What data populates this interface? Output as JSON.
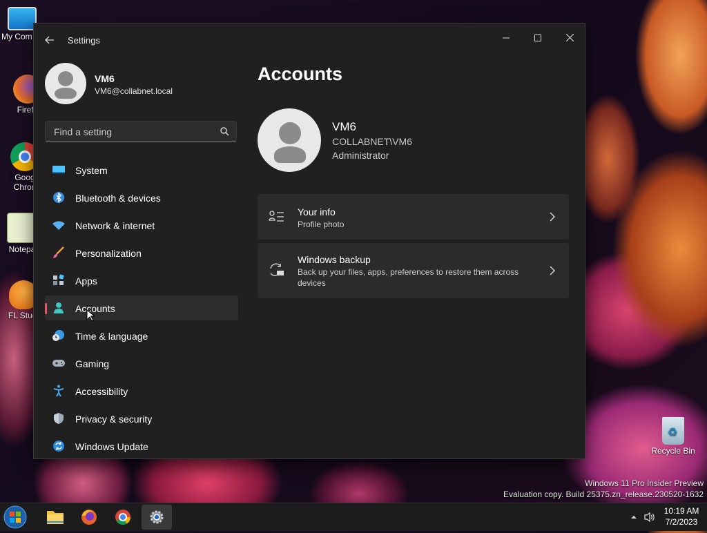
{
  "desktop": {
    "icons": [
      {
        "label": "My Com"
      },
      {
        "label": "Firefo"
      },
      {
        "label": "Goog"
      },
      {
        "label": "Chron"
      },
      {
        "label": "Notepa"
      },
      {
        "label": "FL Studi"
      },
      {
        "label": "Recycle Bin"
      }
    ],
    "watermark": {
      "line1": "Windows 11 Pro Insider Preview",
      "line2": "Evaluation copy. Build 25375.zn_release.230520-1632"
    }
  },
  "window": {
    "title": "Settings",
    "controls": {
      "minimize": "—",
      "maximize": "☐",
      "close": "✕"
    },
    "profile": {
      "name": "VM6",
      "email": "VM6@collabnet.local"
    },
    "search": {
      "placeholder": "Find a setting"
    },
    "nav": [
      {
        "label": "System",
        "icon": "system-icon"
      },
      {
        "label": "Bluetooth & devices",
        "icon": "bluetooth-icon"
      },
      {
        "label": "Network & internet",
        "icon": "wifi-icon"
      },
      {
        "label": "Personalization",
        "icon": "brush-icon"
      },
      {
        "label": "Apps",
        "icon": "apps-icon"
      },
      {
        "label": "Accounts",
        "icon": "person-icon",
        "active": true
      },
      {
        "label": "Time & language",
        "icon": "globe-clock-icon"
      },
      {
        "label": "Gaming",
        "icon": "gamepad-icon"
      },
      {
        "label": "Accessibility",
        "icon": "accessibility-icon"
      },
      {
        "label": "Privacy & security",
        "icon": "shield-icon"
      },
      {
        "label": "Windows Update",
        "icon": "update-icon"
      }
    ],
    "page": {
      "title": "Accounts",
      "account": {
        "name": "VM6",
        "domain": "COLLABNET\\VM6",
        "role": "Administrator"
      },
      "cards": [
        {
          "title": "Your info",
          "subtitle": "Profile photo",
          "icon": "your-info-icon"
        },
        {
          "title": "Windows backup",
          "subtitle": "Back up your files, apps, preferences to restore them across devices",
          "icon": "backup-icon"
        }
      ]
    }
  },
  "taskbar": {
    "apps": [
      "start-button",
      "file-explorer",
      "firefox",
      "chrome",
      "settings"
    ],
    "active_app": "settings",
    "clock": {
      "time": "10:19 AM",
      "date": "7/2/2023"
    }
  },
  "colors": {
    "window_bg": "#202020",
    "card_bg": "#2b2b2b",
    "accent_indicator": "#e05a6a",
    "taskbar_bg": "#1c1c1c"
  }
}
